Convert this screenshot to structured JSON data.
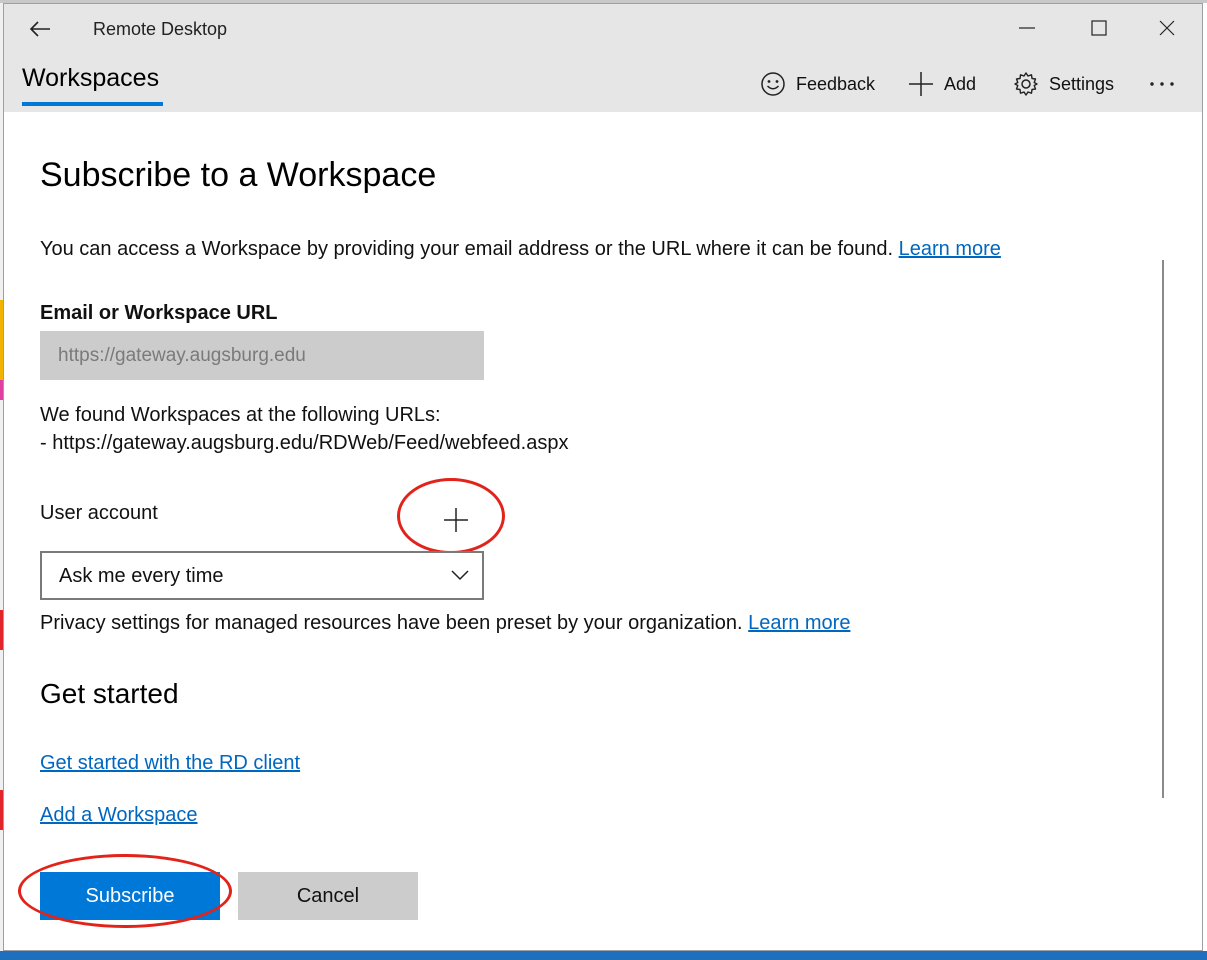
{
  "window": {
    "app_title": "Remote Desktop"
  },
  "nav": {
    "workspaces_label": "Workspaces"
  },
  "commands": {
    "feedback_label": "Feedback",
    "add_label": "Add",
    "settings_label": "Settings"
  },
  "icons": {
    "back": "back-arrow-icon",
    "minimize": "minimize-icon",
    "maximize": "maximize-icon",
    "close": "close-icon",
    "feedback": "smiley-icon",
    "add": "plus-icon",
    "settings": "gear-icon",
    "more": "more-dots-icon",
    "add_account": "plus-icon",
    "dropdown": "chevron-down-icon"
  },
  "main": {
    "heading": "Subscribe to a Workspace",
    "description": "You can access a Workspace by providing your email address or the URL where it can be found.",
    "description_link": "Learn more",
    "email_label": "Email or Workspace URL",
    "email_placeholder": "https://gateway.augsburg.edu",
    "email_value": "",
    "found_intro": "We found Workspaces at the following URLs:",
    "found_url": "- https://gateway.augsburg.edu/RDWeb/Feed/webfeed.aspx",
    "user_account_label": "User account",
    "user_account_selected": "Ask me every time",
    "privacy_text": "Privacy settings for managed resources have been preset by your organization.",
    "privacy_link": "Learn more",
    "get_started_heading": "Get started",
    "link_get_started": "Get started with the RD client",
    "link_add_workspace": "Add a Workspace",
    "subscribe_label": "Subscribe",
    "cancel_label": "Cancel"
  },
  "colors": {
    "accent": "#0078d7",
    "link": "#0067c0",
    "annotation_ring": "#e2231a",
    "chrome_bg": "#e6e6e6",
    "input_bg": "#cccccc"
  }
}
